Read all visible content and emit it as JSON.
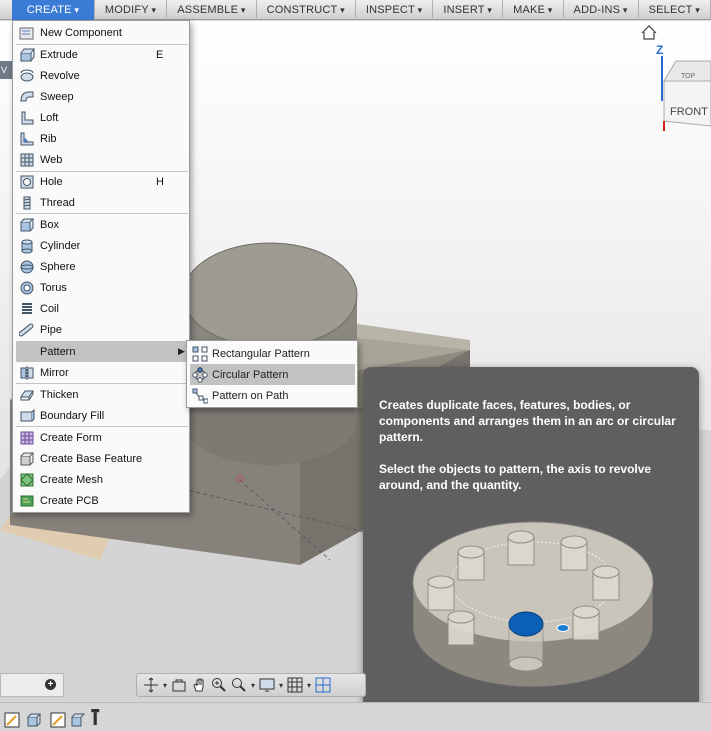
{
  "toolbar": {
    "items": [
      "CREATE",
      "MODIFY",
      "ASSEMBLE",
      "CONSTRUCT",
      "INSPECT",
      "INSERT",
      "MAKE",
      "ADD-INS",
      "SELECT"
    ]
  },
  "viewcube": {
    "axis_label": "Z",
    "top_label": "TOP",
    "front_label": "FRONT"
  },
  "viewport": {
    "side_tab": "V"
  },
  "create_menu": {
    "items": [
      {
        "label": "New Component",
        "shortcut": "",
        "icon": "new-component-icon"
      },
      {
        "label": "Extrude",
        "shortcut": "E",
        "icon": "extrude-icon"
      },
      {
        "label": "Revolve",
        "shortcut": "",
        "icon": "revolve-icon"
      },
      {
        "label": "Sweep",
        "shortcut": "",
        "icon": "sweep-icon"
      },
      {
        "label": "Loft",
        "shortcut": "",
        "icon": "loft-icon"
      },
      {
        "label": "Rib",
        "shortcut": "",
        "icon": "rib-icon"
      },
      {
        "label": "Web",
        "shortcut": "",
        "icon": "web-icon"
      },
      {
        "label": "Hole",
        "shortcut": "H",
        "icon": "hole-icon"
      },
      {
        "label": "Thread",
        "shortcut": "",
        "icon": "thread-icon"
      },
      {
        "label": "Box",
        "shortcut": "",
        "icon": "box-icon"
      },
      {
        "label": "Cylinder",
        "shortcut": "",
        "icon": "cylinder-icon"
      },
      {
        "label": "Sphere",
        "shortcut": "",
        "icon": "sphere-icon"
      },
      {
        "label": "Torus",
        "shortcut": "",
        "icon": "torus-icon"
      },
      {
        "label": "Coil",
        "shortcut": "",
        "icon": "coil-icon"
      },
      {
        "label": "Pipe",
        "shortcut": "",
        "icon": "pipe-icon"
      },
      {
        "label": "Pattern",
        "shortcut": "",
        "icon": ""
      },
      {
        "label": "Mirror",
        "shortcut": "",
        "icon": "mirror-icon"
      },
      {
        "label": "Thicken",
        "shortcut": "",
        "icon": "thicken-icon"
      },
      {
        "label": "Boundary Fill",
        "shortcut": "",
        "icon": "boundary-fill-icon"
      },
      {
        "label": "Create Form",
        "shortcut": "",
        "icon": "create-form-icon"
      },
      {
        "label": "Create Base Feature",
        "shortcut": "",
        "icon": "create-base-feature-icon"
      },
      {
        "label": "Create Mesh",
        "shortcut": "",
        "icon": "create-mesh-icon"
      },
      {
        "label": "Create PCB",
        "shortcut": "",
        "icon": "create-pcb-icon"
      }
    ]
  },
  "pattern_submenu": {
    "items": [
      {
        "label": "Rectangular Pattern",
        "icon": "rectangular-pattern-icon"
      },
      {
        "label": "Circular Pattern",
        "icon": "circular-pattern-icon"
      },
      {
        "label": "Pattern on Path",
        "icon": "pattern-on-path-icon"
      }
    ],
    "highlighted": "Circular Pattern"
  },
  "tooltip": {
    "description": "Creates duplicate faces, features, bodies, or components and arranges them in an arc or circular pattern.",
    "instructions": "Select the objects to pattern, the axis to revolve around, and the quantity."
  },
  "colors": {
    "accent": "#3a7bd5",
    "highlight": "#c2c2c2",
    "tooltip_bg": "#5f5f5f",
    "body": "#8f8a7f"
  }
}
